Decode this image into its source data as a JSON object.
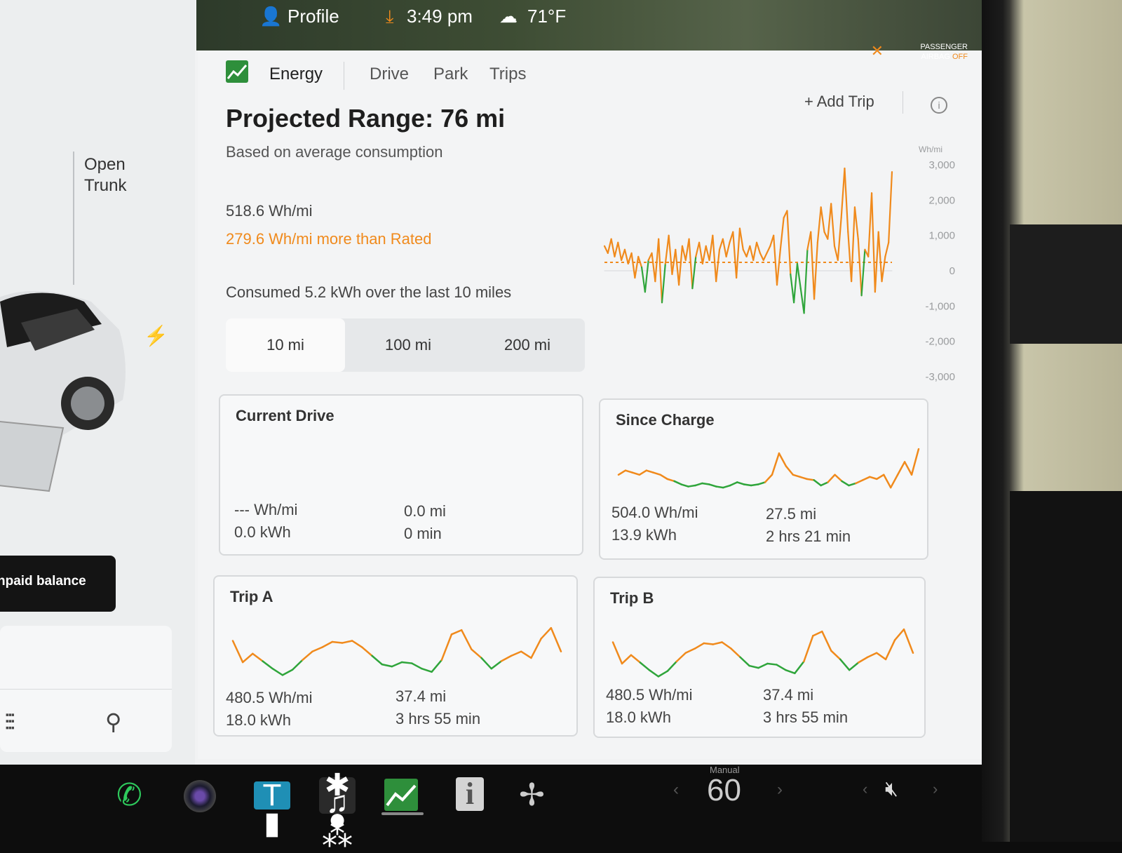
{
  "status_bar": {
    "profile_label": "Profile",
    "time": "3:49 pm",
    "temperature": "71°F",
    "airbag_line1": "PASSENGER",
    "airbag_line2": "AIRBAG",
    "airbag_state": "OFF",
    "icons": [
      "profile-icon",
      "download-icon",
      "cloud-icon",
      "airbag-icon"
    ]
  },
  "left_pane": {
    "trunk_line1": "Open",
    "trunk_line2": "Trunk",
    "balance_text": "npaid balance",
    "icons": [
      "bolt-icon",
      "equalizer-icon",
      "search-icon"
    ]
  },
  "tabs": [
    {
      "label": "Energy",
      "active": true
    },
    {
      "label": "Drive",
      "active": false
    },
    {
      "label": "Park",
      "active": false
    },
    {
      "label": "Trips",
      "active": false
    }
  ],
  "add_trip_label": "+ Add Trip",
  "projected_range": "Projected Range: 76 mi",
  "projected_sub": "Based on average consumption",
  "consumption": "518.6 Wh/mi",
  "delta_rated": "279.6 Wh/mi more than Rated",
  "consumed_text": "Consumed 5.2 kWh over the last 10 miles",
  "distance_options": [
    {
      "label": "10 mi",
      "selected": true
    },
    {
      "label": "100 mi",
      "selected": false
    },
    {
      "label": "200 mi",
      "selected": false
    }
  ],
  "colors": {
    "positive": "#f08a1c",
    "negative": "#2fa53b",
    "accent": "#2e8f3b"
  },
  "chart_data": {
    "type": "line",
    "ylabel": "Wh/mi",
    "ylim": [
      -3000,
      3000
    ],
    "yticks": [
      "3,000",
      "2,000",
      "1,000",
      "0",
      "-1,000",
      "-2,000",
      "-3,000"
    ],
    "rated_line": 239,
    "series": [
      {
        "values": [
          700,
          500,
          900,
          400,
          800,
          300,
          600,
          200,
          500,
          -200,
          400,
          100,
          -600,
          300,
          500,
          -300,
          900,
          -900,
          200,
          1000,
          -100,
          600,
          -400,
          700,
          300,
          900,
          -500,
          400,
          800,
          200,
          700,
          300,
          1000,
          -300,
          600,
          900,
          400,
          800,
          1100,
          -200,
          1200,
          600,
          400,
          700,
          300,
          800,
          500,
          300,
          500,
          700,
          1000,
          -400,
          600,
          1500,
          1700,
          -100,
          -900,
          200,
          -500,
          -1200,
          600,
          1100,
          -800,
          800,
          1800,
          1100,
          900,
          1900,
          700,
          300,
          1500,
          2900,
          1100,
          -300,
          1800,
          900,
          -700,
          600,
          400,
          2200,
          -600,
          1100,
          -300,
          400,
          800,
          2800
        ]
      }
    ]
  },
  "cards": [
    {
      "title": "Current Drive",
      "whmi": "--- Wh/mi",
      "kwh": "0.0 kWh",
      "miles": "0.0 mi",
      "duration": "0 min",
      "spark": []
    },
    {
      "title": "Since Charge",
      "whmi": "504.0 Wh/mi",
      "kwh": "13.9 kWh",
      "miles": "27.5 mi",
      "duration": "2 hrs 21 min",
      "spark": [
        520,
        560,
        540,
        520,
        560,
        540,
        520,
        480,
        460,
        430,
        410,
        420,
        440,
        430,
        410,
        400,
        420,
        450,
        430,
        420,
        430,
        450,
        520,
        720,
        600,
        520,
        500,
        480,
        470,
        420,
        450,
        520,
        460,
        420,
        440,
        470,
        500,
        480,
        520,
        400,
        520,
        640,
        520,
        760
      ]
    },
    {
      "title": "Trip A",
      "whmi": "480.5 Wh/mi",
      "kwh": "18.0 kWh",
      "miles": "37.4 mi",
      "duration": "3 hrs 55 min",
      "spark": [
        620,
        420,
        500,
        430,
        360,
        300,
        350,
        440,
        520,
        560,
        610,
        600,
        620,
        560,
        480,
        400,
        380,
        420,
        410,
        360,
        330,
        440,
        680,
        720,
        540,
        460,
        360,
        430,
        480,
        520,
        460,
        640,
        740,
        520
      ]
    },
    {
      "title": "Trip B",
      "whmi": "480.5 Wh/mi",
      "kwh": "18.0 kWh",
      "miles": "37.4 mi",
      "duration": "3 hrs 55 min",
      "spark": [
        620,
        420,
        500,
        430,
        360,
        300,
        350,
        440,
        520,
        560,
        610,
        600,
        620,
        560,
        480,
        400,
        380,
        420,
        410,
        360,
        330,
        440,
        680,
        720,
        540,
        460,
        360,
        430,
        480,
        520,
        460,
        640,
        740,
        520
      ]
    }
  ],
  "dock": {
    "manual_label": "Manual",
    "speed": "60",
    "icons": [
      "phone-icon",
      "camera-icon",
      "toybox-icon",
      "apps-icon",
      "energy-app-icon",
      "manual-icon",
      "fan-icon",
      "mute-icon"
    ]
  }
}
